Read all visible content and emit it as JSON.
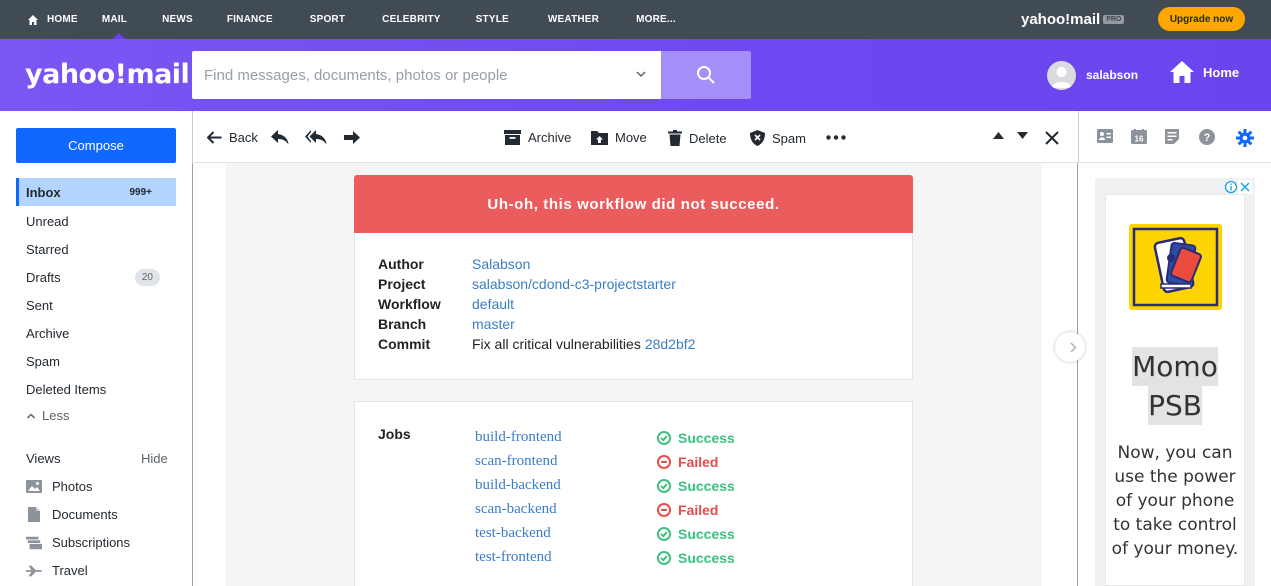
{
  "topnav": {
    "items": [
      {
        "label": "HOME",
        "active": false
      },
      {
        "label": "MAIL",
        "active": true
      },
      {
        "label": "NEWS",
        "active": false
      },
      {
        "label": "FINANCE",
        "active": false
      },
      {
        "label": "SPORT",
        "active": false
      },
      {
        "label": "CELEBRITY",
        "active": false
      },
      {
        "label": "STYLE",
        "active": false
      },
      {
        "label": "WEATHER",
        "active": false
      },
      {
        "label": "MORE...",
        "active": false
      }
    ],
    "logo_text": "yahoo!mail",
    "logo_badge": "PRO",
    "upgrade_label": "Upgrade now"
  },
  "header": {
    "brand": "yahoo!mail",
    "search_placeholder": "Find messages, documents, photos or people",
    "username": "salabson",
    "home_label": "Home"
  },
  "sidebar": {
    "compose_label": "Compose",
    "folders": [
      {
        "label": "Inbox",
        "count": "999+",
        "active": true
      },
      {
        "label": "Unread"
      },
      {
        "label": "Starred"
      },
      {
        "label": "Drafts",
        "count": "20"
      },
      {
        "label": "Sent"
      },
      {
        "label": "Archive"
      },
      {
        "label": "Spam"
      },
      {
        "label": "Deleted Items"
      }
    ],
    "less_label": "Less",
    "views_label": "Views",
    "hide_label": "Hide",
    "views": [
      {
        "label": "Photos",
        "icon": "photo-icon"
      },
      {
        "label": "Documents",
        "icon": "document-icon"
      },
      {
        "label": "Subscriptions",
        "icon": "subscriptions-icon"
      },
      {
        "label": "Travel",
        "icon": "plane-icon"
      }
    ]
  },
  "toolbar": {
    "back_label": "Back",
    "archive_label": "Archive",
    "move_label": "Move",
    "delete_label": "Delete",
    "spam_label": "Spam"
  },
  "message": {
    "banner": "Uh-oh, this workflow did not succeed.",
    "details": [
      {
        "key": "Author",
        "value": "Salabson"
      },
      {
        "key": "Project",
        "value": "salabson/cdond-c3-projectstarter"
      },
      {
        "key": "Workflow",
        "value": "default"
      },
      {
        "key": "Branch",
        "value": "master"
      },
      {
        "key": "Commit",
        "value": "Fix all critical vulnerabilities",
        "link": "28d2bf2"
      }
    ],
    "jobs_label": "Jobs",
    "jobs": [
      {
        "name": "build-frontend",
        "status": "Success"
      },
      {
        "name": "scan-frontend",
        "status": "Failed"
      },
      {
        "name": "build-backend",
        "status": "Success"
      },
      {
        "name": "scan-backend",
        "status": "Failed"
      },
      {
        "name": "test-backend",
        "status": "Success"
      },
      {
        "name": "test-frontend",
        "status": "Success"
      }
    ]
  },
  "ad": {
    "title_line1": "Momo",
    "title_line2": "PSB",
    "body": "Now, you can use the power of your phone to take control of your money."
  },
  "colors": {
    "accent": "#6d48f0",
    "compose": "#0f69ff",
    "banner": "#eb5c5c",
    "success": "#3cc282",
    "failed": "#e54d4d",
    "link": "#3b7dc4"
  }
}
